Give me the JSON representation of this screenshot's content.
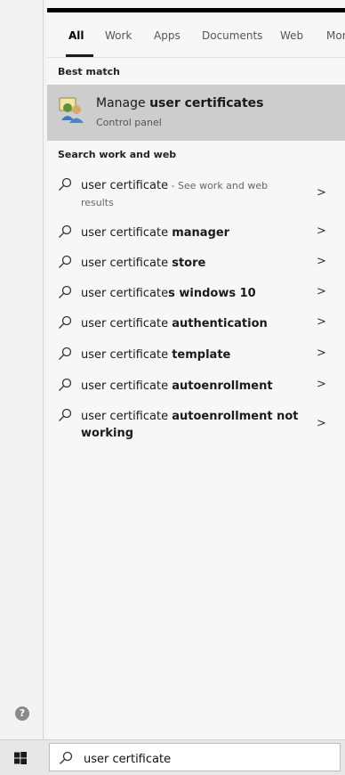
{
  "tabs": [
    {
      "label": "All",
      "active": true
    },
    {
      "label": "Work"
    },
    {
      "label": "Apps"
    },
    {
      "label": "Documents"
    },
    {
      "label": "Web"
    },
    {
      "label": "Mor"
    }
  ],
  "best_match": {
    "header": "Best match",
    "title_prefix": "Manage ",
    "title_bold": "user certificates",
    "subtitle": "Control panel",
    "icon": "users-certificate-icon"
  },
  "search_section": {
    "header": "Search work and web",
    "suggestions": [
      {
        "prefix": "user certificate",
        "bold": "",
        "sub": " - See work and web results"
      },
      {
        "prefix": "user certificate ",
        "bold": "manager",
        "sub": ""
      },
      {
        "prefix": "user certificate ",
        "bold": "store",
        "sub": ""
      },
      {
        "prefix": "user certificate",
        "bold": "s windows 10",
        "sub": ""
      },
      {
        "prefix": "user certificate ",
        "bold": "authentication",
        "sub": ""
      },
      {
        "prefix": "user certificate ",
        "bold": "template",
        "sub": ""
      },
      {
        "prefix": "user certificate ",
        "bold": "autoenrollment",
        "sub": ""
      },
      {
        "prefix": "user certificate ",
        "bold": "autoenrollment not working",
        "sub": ""
      }
    ],
    "chevron": ">"
  },
  "help_label": "?",
  "taskbar": {
    "search_value": "user certificate",
    "search_icon": "search-icon",
    "start_icon": "windows-start-icon"
  }
}
